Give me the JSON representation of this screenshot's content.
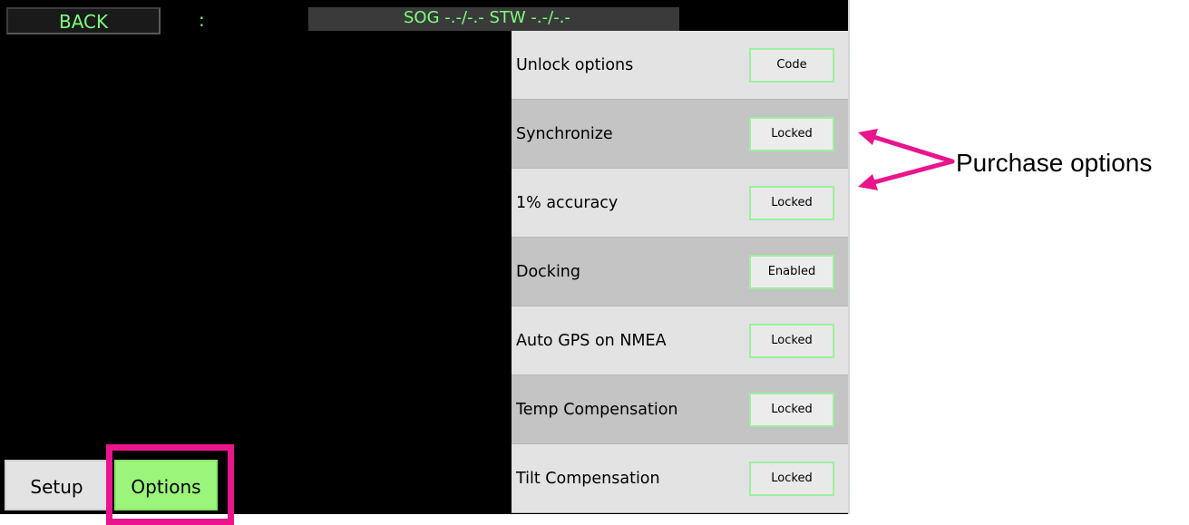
{
  "header": {
    "back_label": "BACK",
    "separator": ":",
    "status_text": "SOG -.-/-.- STW -.-/-.-"
  },
  "options": [
    {
      "label": "Unlock options",
      "button": "Code"
    },
    {
      "label": "Synchronize",
      "button": "Locked"
    },
    {
      "label": "1% accuracy",
      "button": "Locked"
    },
    {
      "label": "Docking",
      "button": "Enabled"
    },
    {
      "label": "Auto GPS on NMEA",
      "button": "Locked"
    },
    {
      "label": "Temp Compensation",
      "button": "Locked"
    },
    {
      "label": "Tilt Compensation",
      "button": "Locked"
    }
  ],
  "tabs": {
    "setup": "Setup",
    "options": "Options",
    "active": "Options"
  },
  "annotation": {
    "label": "Purchase options",
    "color": "#ea148c"
  },
  "colors": {
    "accent_green": "#7dff7d",
    "active_tab": "#9af57a",
    "button_border": "#9df09d",
    "highlight": "#ea148c"
  },
  "icons": [
    "annotation-arrow-icon"
  ]
}
